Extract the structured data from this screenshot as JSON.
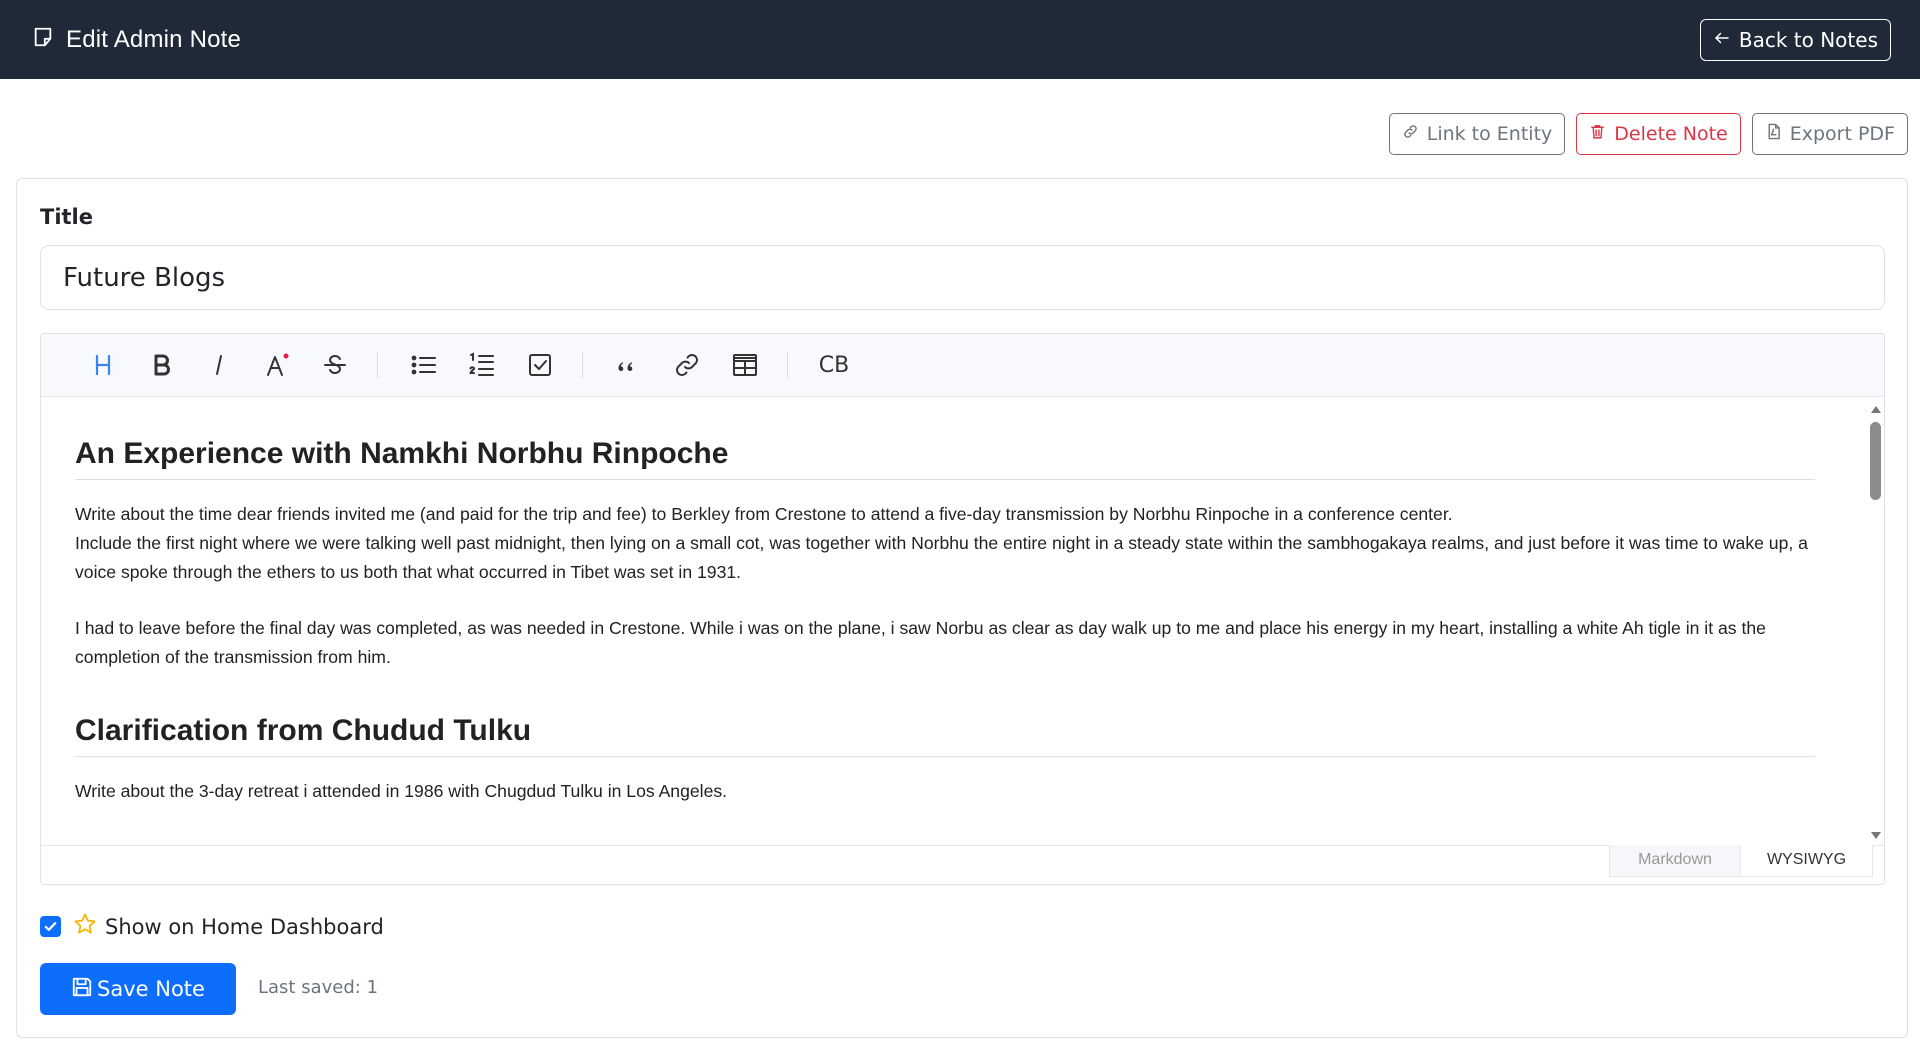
{
  "header": {
    "title": "Edit Admin Note",
    "back_label": "Back to Notes"
  },
  "actions": {
    "link_label": "Link to Entity",
    "delete_label": "Delete Note",
    "export_label": "Export PDF"
  },
  "form": {
    "title_label": "Title",
    "title_value": "Future Blogs"
  },
  "editor": {
    "toolbar": {
      "code_block_label": "CB"
    },
    "content": {
      "heading1": "An Experience with Namkhi Norbhu Rinpoche",
      "p1": "Write about the time dear friends invited me (and paid for the trip and fee) to Berkley from Crestone to attend a five-day transmission by Norbhu Rinpoche in a conference center.",
      "p2": "Include the first night where we were talking well past midnight, then lying on a small cot, was together with Norbhu the entire night in a steady state within the sambhogakaya realms, and just before it was time to wake up, a voice spoke through the ethers to us both that what occurred in Tibet was set in 1931.",
      "p3": "I had to leave before the final day was completed, as was needed in Crestone. While i was on the plane, i saw Norbu as clear as day walk up to me and place his energy in my heart, installing a white Ah tigle in it as the completion of the transmission from him.",
      "heading2": "Clarification from Chudud Tulku",
      "p4": "Write about the 3-day retreat i attended in 1986 with Chugdud Tulku in Los Angeles."
    },
    "modes": {
      "markdown": "Markdown",
      "wysiwyg": "WYSIWYG",
      "active": "WYSIWYG"
    }
  },
  "dashboard": {
    "label": "Show on Home Dashboard",
    "checked": true
  },
  "footer": {
    "save_label": "Save Note",
    "last_saved": "Last saved: 1"
  },
  "colors": {
    "header_bg": "#1f2937",
    "primary": "#0d6efd",
    "danger": "#dc3545",
    "secondary": "#6c757d",
    "heading_tool_active": "#3b82f6",
    "star": "#f5b301"
  }
}
